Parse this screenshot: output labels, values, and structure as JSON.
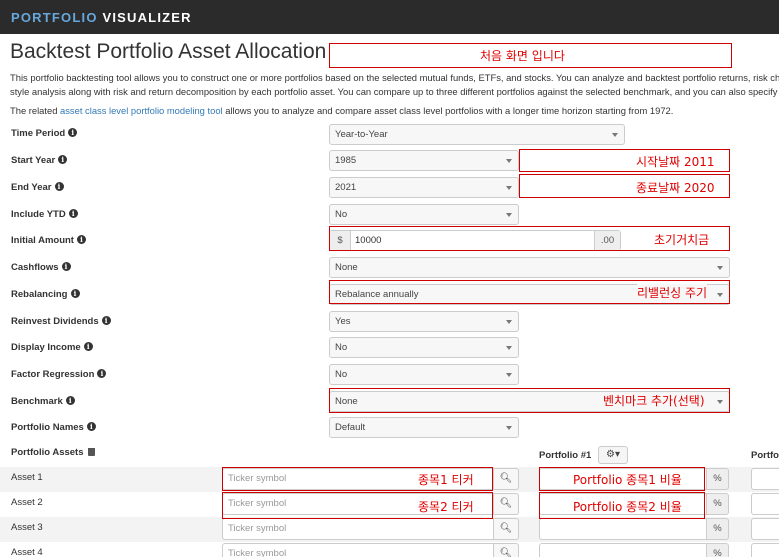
{
  "header": {
    "brand_a": "PORTFOLIO",
    "brand_b": "VISUALIZER"
  },
  "page": {
    "title": "Backtest Portfolio Asset Allocation",
    "desc1": "This portfolio backtesting tool allows you to construct one or more portfolios based on the selected mutual funds, ETFs, and stocks. You can analyze and backtest portfolio returns, risk ch",
    "desc2": "style analysis along with risk and return decomposition by each portfolio asset. You can compare up to three different portfolios against the selected benchmark, and you can also specify",
    "desc3_pre": "The related ",
    "desc3_link": "asset class level portfolio modeling tool",
    "desc3_post": " allows you to analyze and compare asset class level portfolios with a longer time horizon starting from 1972."
  },
  "form": {
    "time_period": {
      "label": "Time Period",
      "value": "Year-to-Year"
    },
    "start_year": {
      "label": "Start Year",
      "value": "1985"
    },
    "end_year": {
      "label": "End Year",
      "value": "2021"
    },
    "include_ytd": {
      "label": "Include YTD",
      "value": "No"
    },
    "initial_amount": {
      "label": "Initial Amount",
      "prefix": "$",
      "value": "10000",
      "suffix": ".00"
    },
    "cashflows": {
      "label": "Cashflows",
      "value": "None"
    },
    "rebalancing": {
      "label": "Rebalancing",
      "value": "Rebalance annually"
    },
    "reinvest": {
      "label": "Reinvest Dividends",
      "value": "Yes"
    },
    "display_income": {
      "label": "Display Income",
      "value": "No"
    },
    "factor_regression": {
      "label": "Factor Regression",
      "value": "No"
    },
    "benchmark": {
      "label": "Benchmark",
      "value": "None"
    },
    "portfolio_names": {
      "label": "Portfolio Names",
      "value": "Default"
    }
  },
  "assets": {
    "heading": "Portfolio Assets",
    "portfolio1": "Portfolio #1",
    "portfolio2": "Portfo",
    "gear": "⚙▾",
    "placeholder": "Ticker symbol",
    "pct": "%",
    "rows": [
      {
        "label": "Asset 1"
      },
      {
        "label": "Asset 2"
      },
      {
        "label": "Asset 3"
      },
      {
        "label": "Asset 4"
      }
    ]
  },
  "annotations": {
    "intro": "처음 화면 입니다",
    "start": "시작날짜 2011",
    "end": "종료날짜 2020",
    "initial": "초기거치금",
    "rebal": "리밸런싱 주기",
    "bench": "벤치마크 추가(선택)",
    "ticker1": "종목1 티커",
    "ticker2": "종목2 티커",
    "pct1": "Portfolio 종목1 비율",
    "pct2": "Portfolio 종목2 비율"
  },
  "colors": {
    "annotation": "#e00000",
    "topbar": "#2b2b2b",
    "brand_accent": "#66a8dd",
    "link": "#337ab7"
  }
}
